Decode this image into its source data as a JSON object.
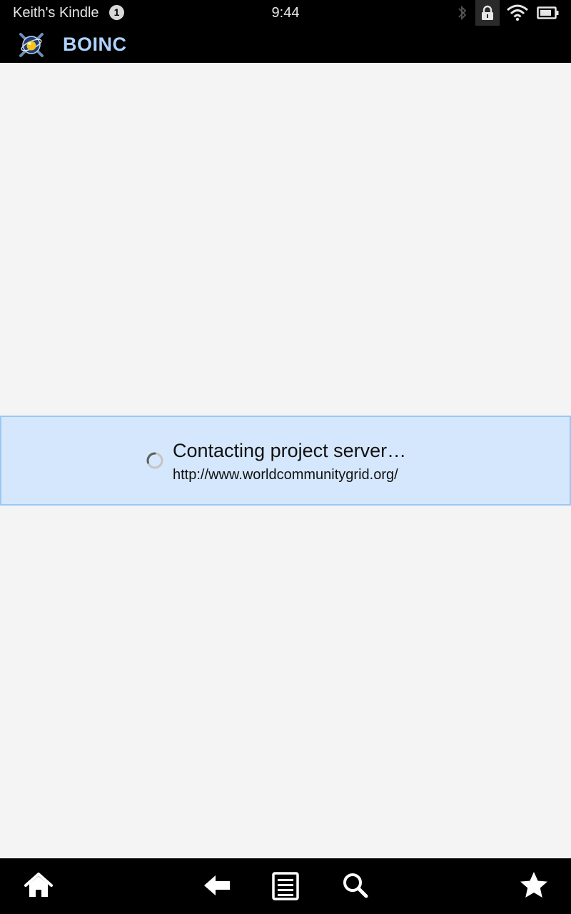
{
  "status_bar": {
    "device_name": "Keith's Kindle",
    "notification_count": "1",
    "time": "9:44",
    "icons": [
      "bluetooth-icon",
      "lock-icon",
      "wifi-icon",
      "battery-icon"
    ]
  },
  "action_bar": {
    "app_title": "BOINC",
    "logo_icon": "boinc-logo-icon",
    "title_color": "#aed3ff"
  },
  "progress": {
    "title": "Contacting project server…",
    "url": "http://www.worldcommunitygrid.org/",
    "panel_color": "#d5e7fc",
    "border_color": "#9cc8f2"
  },
  "nav_bar": {
    "items": [
      "home-icon",
      "back-icon",
      "menu-icon",
      "search-icon",
      "favorites-icon"
    ]
  }
}
